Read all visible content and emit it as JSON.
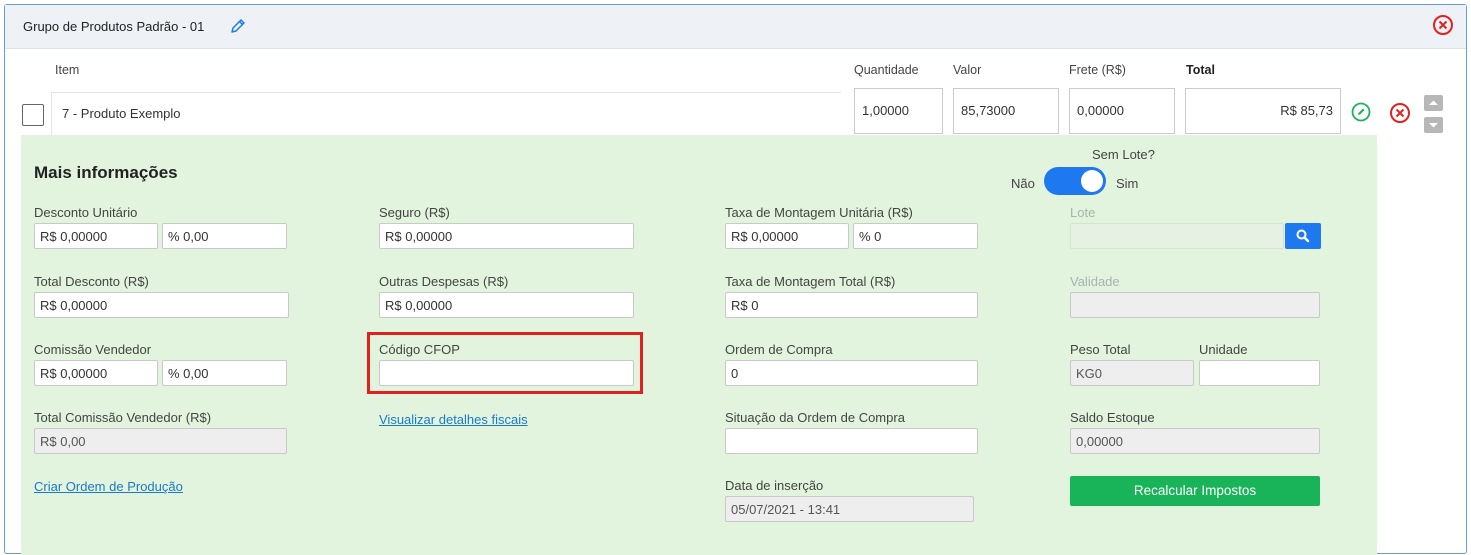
{
  "header": {
    "title": "Grupo de Produtos Padrão - 01"
  },
  "columns": {
    "item": "Item",
    "quantidade": "Quantidade",
    "valor": "Valor",
    "frete": "Frete (R$)",
    "total": "Total"
  },
  "row": {
    "item": "7 - Produto Exemplo",
    "quantidade": "1,00000",
    "valor": "85,73000",
    "frete": "0,00000",
    "total": "R$ 85,73"
  },
  "info": {
    "title": "Mais informações",
    "sem_lote": {
      "label": "Sem Lote?",
      "off": "Não",
      "on": "Sim",
      "checked": true
    },
    "desconto_unitario": {
      "label": "Desconto Unitário",
      "valor": "R$ 0,00000",
      "percent": "% 0,00"
    },
    "seguro": {
      "label": "Seguro (R$)",
      "valor": "R$ 0,00000"
    },
    "taxa_montagem_unitaria": {
      "label": "Taxa de Montagem Unitária (R$)",
      "valor": "R$ 0,00000",
      "percent": "% 0"
    },
    "lote": {
      "label": "Lote",
      "valor": ""
    },
    "total_desconto": {
      "label": "Total Desconto (R$)",
      "valor": "R$ 0,00000"
    },
    "outras_despesas": {
      "label": "Outras Despesas (R$)",
      "valor": "R$ 0,00000"
    },
    "taxa_montagem_total": {
      "label": "Taxa de Montagem Total (R$)",
      "valor": "R$ 0"
    },
    "validade": {
      "label": "Validade",
      "valor": ""
    },
    "comissao_vendedor": {
      "label": "Comissão Vendedor",
      "valor": "R$ 0,00000",
      "percent": "% 0,00"
    },
    "codigo_cfop": {
      "label": "Código CFOP",
      "valor": ""
    },
    "ordem_compra": {
      "label": "Ordem de Compra",
      "valor": "0"
    },
    "peso_total": {
      "label": "Peso Total",
      "valor": "KG0"
    },
    "unidade": {
      "label": "Unidade",
      "valor": ""
    },
    "total_comissao": {
      "label": "Total Comissão Vendedor (R$)",
      "valor": "R$ 0,00"
    },
    "link_fiscais": "Visualizar detalhes fiscais",
    "situacao_ordem": {
      "label": "Situação da Ordem de Compra",
      "valor": ""
    },
    "saldo_estoque": {
      "label": "Saldo Estoque",
      "valor": "0,00000"
    },
    "link_producao": "Criar Ordem de Produção",
    "data_insercao": {
      "label": "Data de inserção",
      "valor": "05/07/2021 - 13:41"
    },
    "recalcular": "Recalcular Impostos"
  },
  "colors": {
    "accent": "#1e78f0",
    "info_bg": "#e2f4dd",
    "success": "#19b35a",
    "danger": "#e32020"
  }
}
